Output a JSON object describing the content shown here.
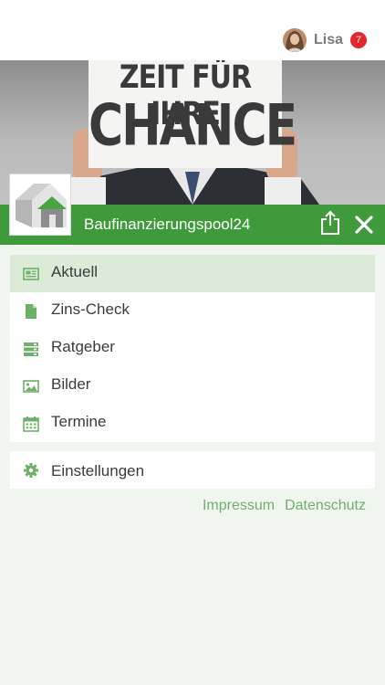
{
  "user": {
    "name": "Lisa",
    "notifications": "7"
  },
  "hero": {
    "sign_line1": "ZEIT FÜR IHRE",
    "sign_line2": "CHANCE"
  },
  "brand": {
    "name": "Baufinanzierungspool24"
  },
  "colors": {
    "primary_green": "#3f9a3b",
    "icon_green": "#6fb06a",
    "active_bg": "#dbebd8",
    "badge_red": "#e5262d"
  },
  "menu": {
    "items": [
      {
        "label": "Aktuell",
        "icon": "newspaper-icon",
        "active": true
      },
      {
        "label": "Zins-Check",
        "icon": "document-icon",
        "active": false
      },
      {
        "label": "Ratgeber",
        "icon": "server-list-icon",
        "active": false
      },
      {
        "label": "Bilder",
        "icon": "image-icon",
        "active": false
      },
      {
        "label": "Termine",
        "icon": "calendar-icon",
        "active": false
      }
    ],
    "settings": {
      "label": "Einstellungen",
      "icon": "gear-icon"
    }
  },
  "footer": {
    "impressum": "Impressum",
    "datenschutz": "Datenschutz"
  }
}
